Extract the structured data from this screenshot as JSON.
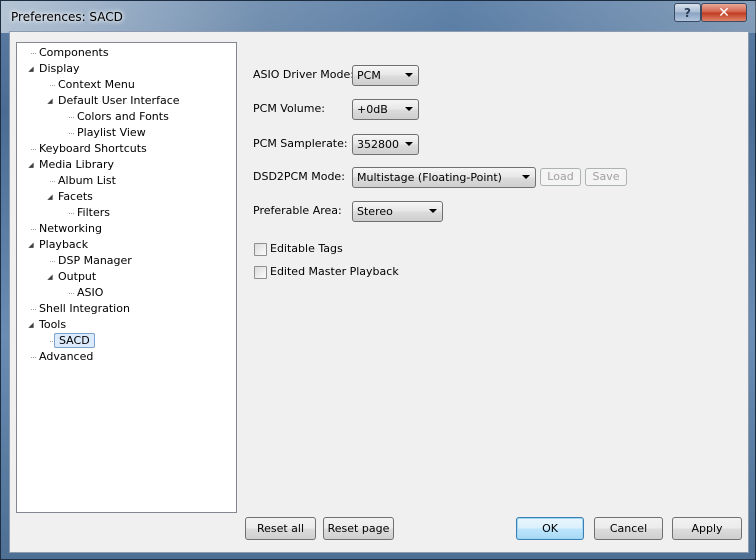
{
  "window": {
    "title": "Preferences: SACD",
    "help_glyph": "?",
    "close_glyph": "✕"
  },
  "tree": {
    "items": [
      {
        "label": "Components",
        "level": 0,
        "expander": ""
      },
      {
        "label": "Display",
        "level": 0,
        "expander": "open"
      },
      {
        "label": "Context Menu",
        "level": 1,
        "expander": ""
      },
      {
        "label": "Default User Interface",
        "level": 1,
        "expander": "open"
      },
      {
        "label": "Colors and Fonts",
        "level": 2,
        "expander": ""
      },
      {
        "label": "Playlist View",
        "level": 2,
        "expander": ""
      },
      {
        "label": "Keyboard Shortcuts",
        "level": 0,
        "expander": ""
      },
      {
        "label": "Media Library",
        "level": 0,
        "expander": "open"
      },
      {
        "label": "Album List",
        "level": 1,
        "expander": ""
      },
      {
        "label": "Facets",
        "level": 1,
        "expander": "open"
      },
      {
        "label": "Filters",
        "level": 2,
        "expander": ""
      },
      {
        "label": "Networking",
        "level": 0,
        "expander": ""
      },
      {
        "label": "Playback",
        "level": 0,
        "expander": "open"
      },
      {
        "label": "DSP Manager",
        "level": 1,
        "expander": ""
      },
      {
        "label": "Output",
        "level": 1,
        "expander": "open"
      },
      {
        "label": "ASIO",
        "level": 2,
        "expander": ""
      },
      {
        "label": "Shell Integration",
        "level": 0,
        "expander": ""
      },
      {
        "label": "Tools",
        "level": 0,
        "expander": "open"
      },
      {
        "label": "SACD",
        "level": 1,
        "expander": "",
        "selected": true
      },
      {
        "label": "Advanced",
        "level": 0,
        "expander": ""
      }
    ]
  },
  "settings": {
    "asio_driver_mode": {
      "label": "ASIO Driver Mode:",
      "value": "PCM"
    },
    "pcm_volume": {
      "label": "PCM Volume:",
      "value": "+0dB"
    },
    "pcm_samplerate": {
      "label": "PCM Samplerate:",
      "value": "352800"
    },
    "dsd2pcm_mode": {
      "label": "DSD2PCM Mode:",
      "value": "Multistage (Floating-Point)",
      "load_label": "Load",
      "save_label": "Save"
    },
    "preferable_area": {
      "label": "Preferable Area:",
      "value": "Stereo"
    },
    "editable_tags": {
      "label": "Editable Tags",
      "checked": false
    },
    "edited_master_playback": {
      "label": "Edited Master Playback",
      "checked": false
    }
  },
  "buttons": {
    "reset_all": "Reset all",
    "reset_page": "Reset page",
    "ok": "OK",
    "cancel": "Cancel",
    "apply": "Apply"
  }
}
